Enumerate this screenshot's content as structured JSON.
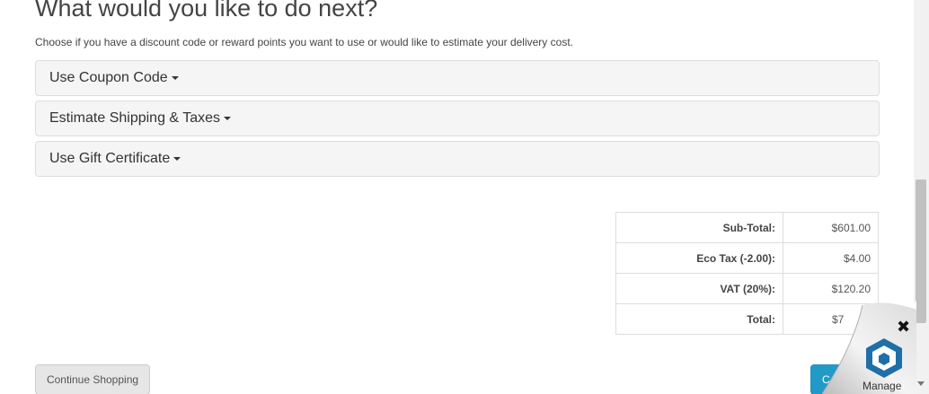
{
  "heading": "What would you like to do next?",
  "intro": "Choose if you have a discount code or reward points you want to use or would like to estimate your delivery cost.",
  "panels": [
    {
      "title": "Use Coupon Code"
    },
    {
      "title": "Estimate Shipping & Taxes"
    },
    {
      "title": "Use Gift Certificate"
    }
  ],
  "totals": [
    {
      "label": "Sub-Total:",
      "value": "$601.00"
    },
    {
      "label": "Eco Tax (-2.00):",
      "value": "$4.00"
    },
    {
      "label": "VAT (20%):",
      "value": "$120.20"
    },
    {
      "label": "Total:",
      "value": "$7"
    }
  ],
  "buttons": {
    "continue": "Continue Shopping",
    "checkout": "C"
  },
  "widget": {
    "label": "Manage",
    "close": "✖"
  }
}
